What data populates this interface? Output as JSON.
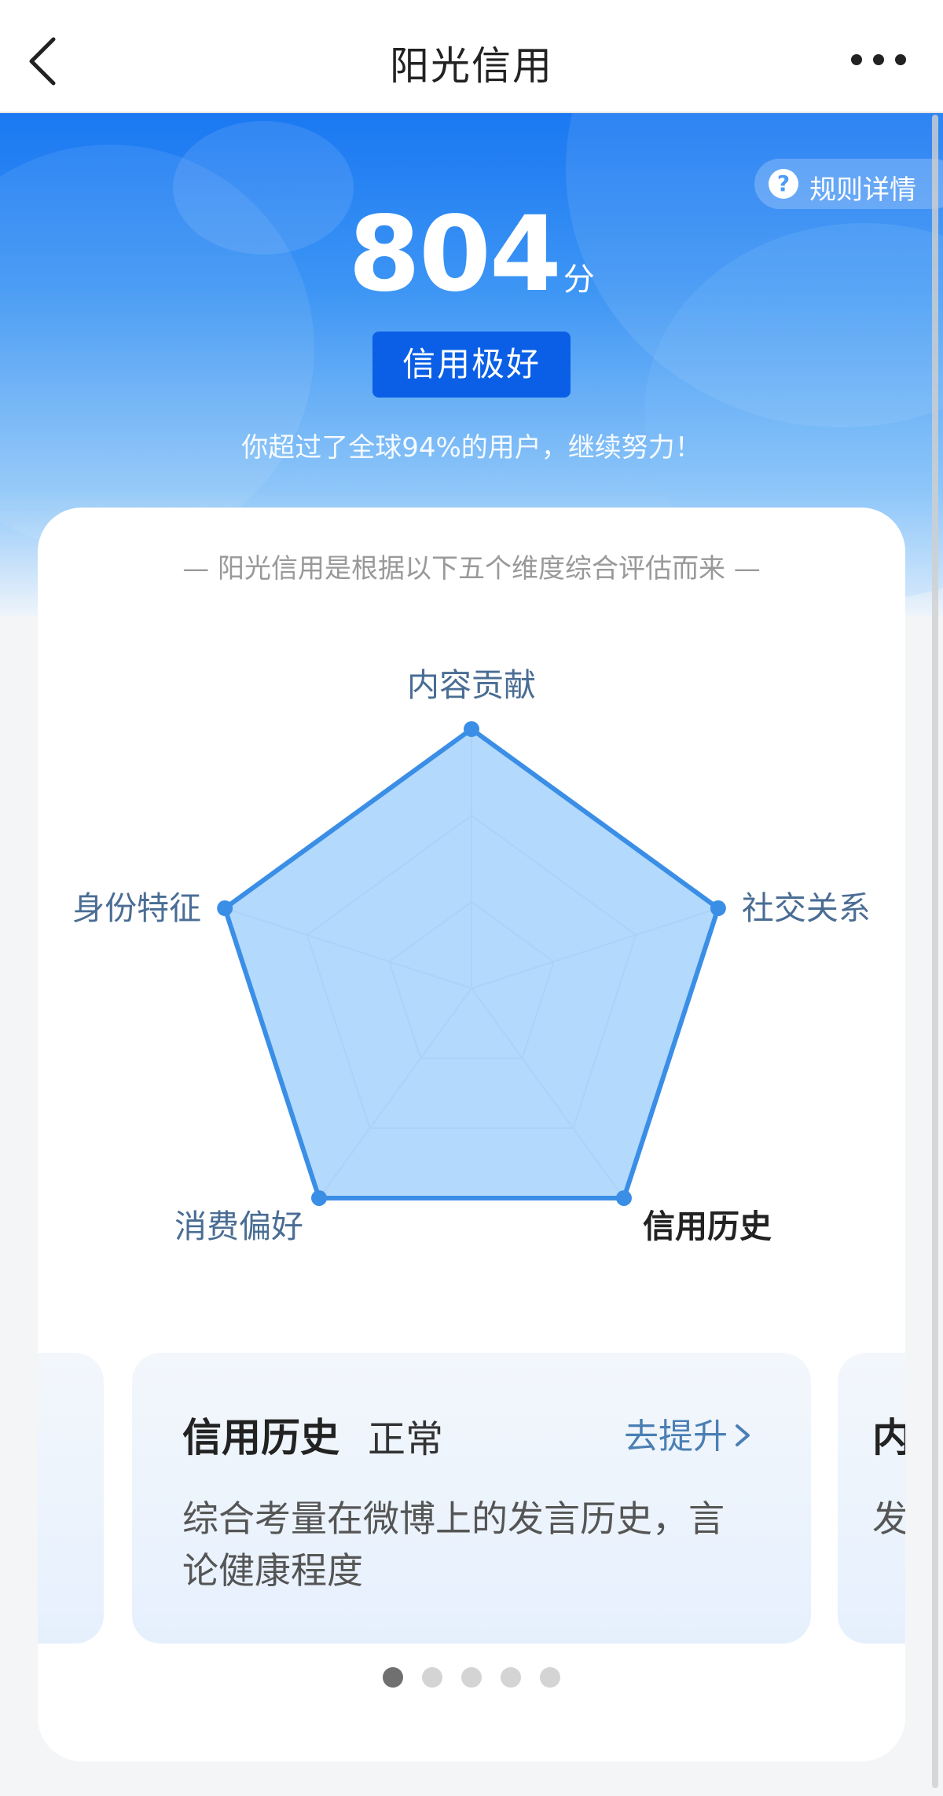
{
  "nav": {
    "title": "阳光信用",
    "back_icon": "back-arrow-icon",
    "more_icon": "more-dots-icon"
  },
  "hero": {
    "score": "804",
    "score_unit": "分",
    "level": "信用极好",
    "percent_text": "你超过了全球94%的用户，继续努力！",
    "rules_label": "规则详情",
    "rules_icon": "question-circle-icon"
  },
  "radar": {
    "subtitle": "— 阳光信用是根据以下五个维度综合评估而来 —",
    "axes": [
      {
        "label": "内容贡献",
        "active": false,
        "value": 1.0
      },
      {
        "label": "社交关系",
        "active": false,
        "value": 1.0
      },
      {
        "label": "信用历史",
        "active": true,
        "value": 1.0
      },
      {
        "label": "消费偏好",
        "active": false,
        "value": 1.0
      },
      {
        "label": "身份特征",
        "active": false,
        "value": 1.0
      }
    ],
    "fill_color": "#a6d2fb",
    "line_color": "#3a8ee6"
  },
  "detail": {
    "title": "信用历史",
    "status": "正常",
    "link": "去提升",
    "link_icon": "chevron-right-icon",
    "description": "综合考量在微博上的发言历史，言论健康程度",
    "peek_right_title": "内",
    "peek_right_desc": "发信"
  },
  "pager": {
    "count": 5,
    "active_index": 0
  }
}
